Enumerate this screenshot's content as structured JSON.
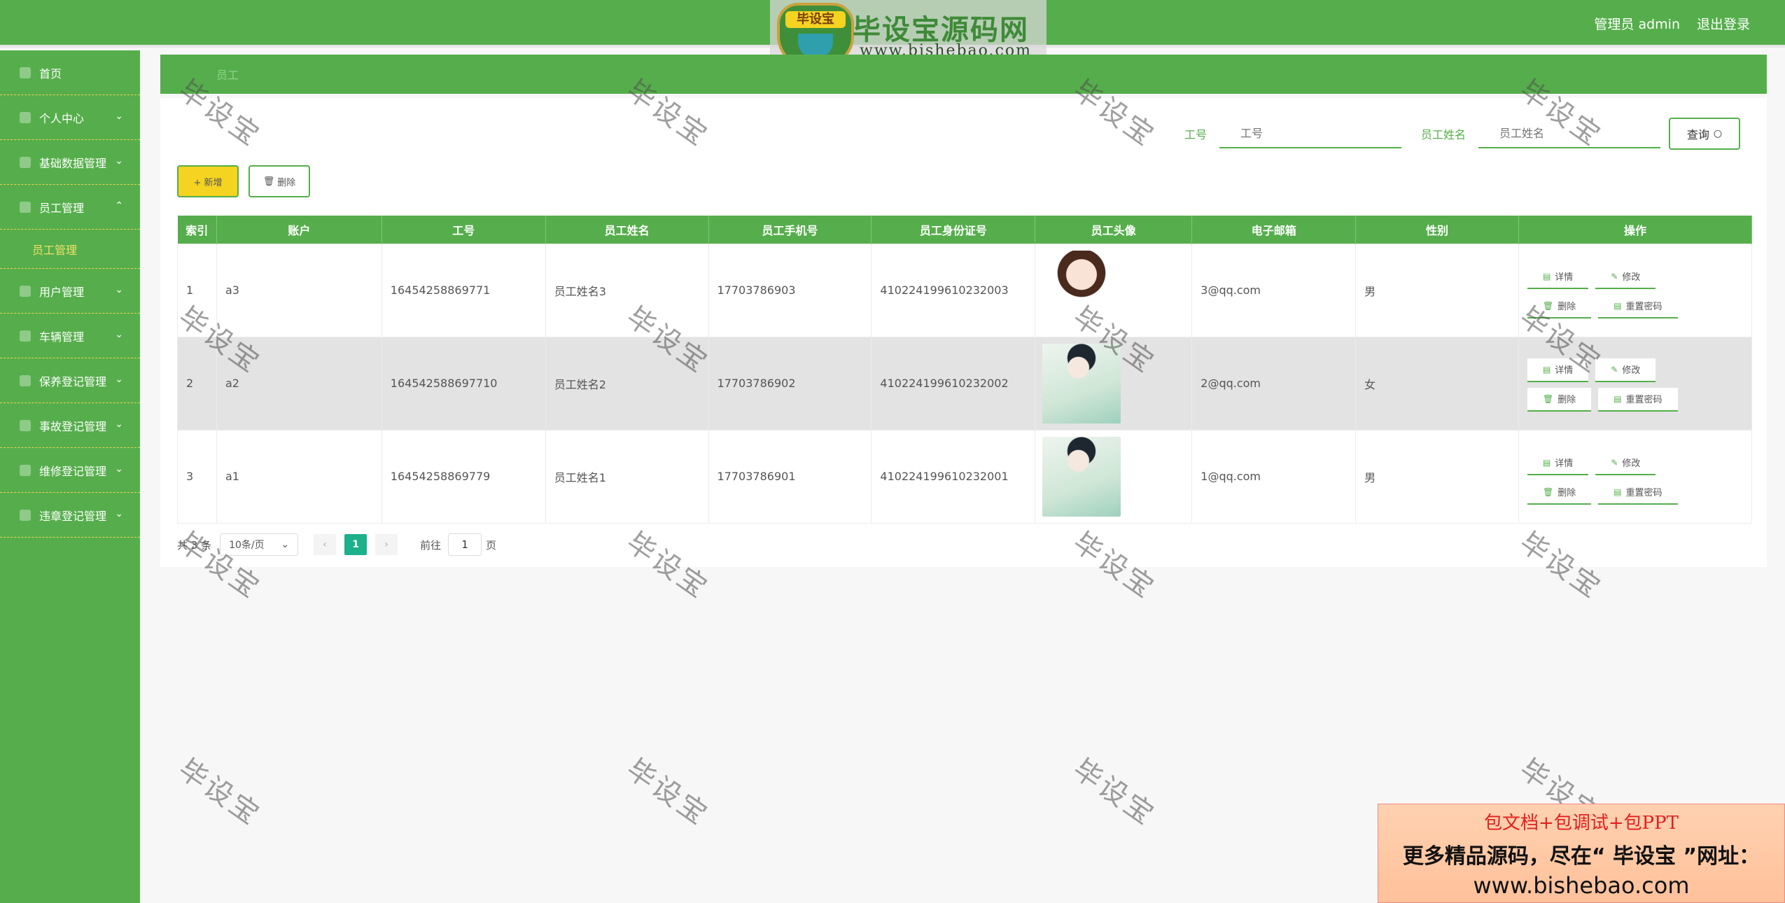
{
  "header": {
    "brand_badge": "毕设宝",
    "brand_name": "毕设宝源码网",
    "brand_url": "www.bishebao.com",
    "user": "管理员 admin",
    "logout": "退出登录"
  },
  "sidebar": {
    "items": [
      {
        "label": "首页",
        "chevron": ""
      },
      {
        "label": "个人中心",
        "chevron": "⌄"
      },
      {
        "label": "基础数据管理",
        "chevron": "⌄"
      },
      {
        "label": "员工管理",
        "chevron": "⌃"
      },
      {
        "label": "用户管理",
        "chevron": "⌄"
      },
      {
        "label": "车辆管理",
        "chevron": "⌄"
      },
      {
        "label": "保养登记管理",
        "chevron": "⌄"
      },
      {
        "label": "事故登记管理",
        "chevron": "⌄"
      },
      {
        "label": "维修登记管理",
        "chevron": "⌄"
      },
      {
        "label": "违章登记管理",
        "chevron": "⌄"
      }
    ],
    "submenu": {
      "label": "员工管理"
    }
  },
  "breadcrumb": "员工",
  "search": {
    "field1_label": "工号",
    "field1_placeholder": "工号",
    "field2_label": "员工姓名",
    "field2_placeholder": "员工姓名",
    "query_button": "查询"
  },
  "actions": {
    "add": "+ 新增",
    "delete": "删除"
  },
  "table": {
    "headers": [
      "索引",
      "账户",
      "工号",
      "员工姓名",
      "员工手机号",
      "员工身份证号",
      "员工头像",
      "电子邮箱",
      "性别",
      "操作"
    ],
    "rows": [
      {
        "index": "1",
        "account": "a3",
        "job_no": "16454258869771",
        "name": "员工姓名3",
        "phone": "17703786903",
        "id_card": "410224199610232003",
        "email": "3@qq.com",
        "gender": "男"
      },
      {
        "index": "2",
        "account": "a2",
        "job_no": "16454258869771​0",
        "name": "员工姓名2",
        "phone": "17703786902",
        "id_card": "410224199610232002",
        "email": "2@qq.com",
        "gender": "女"
      },
      {
        "index": "3",
        "account": "a1",
        "job_no": "16454258869779",
        "name": "员工姓名1",
        "phone": "17703786901",
        "id_card": "410224199610232001",
        "email": "1@qq.com",
        "gender": "男"
      }
    ],
    "ops": {
      "detail": "详情",
      "edit": "修改",
      "delete": "删除",
      "reset": "重置密码"
    }
  },
  "pager": {
    "total": "共 3 条",
    "page_size": "10条/页",
    "current": "1",
    "goto_label": "前往",
    "goto_value": "1",
    "goto_suffix": "页"
  },
  "watermark": "毕设宝",
  "ad": {
    "line1": "包文档+包调试+包PPT",
    "line2": "更多精品源码，尽在“ 毕设宝 ”网址：",
    "line3": "www.bishebao.com"
  },
  "colors": {
    "primary_green": "#55ae4b",
    "accent_yellow": "#f5d321",
    "pager_active": "#1cb08b"
  }
}
